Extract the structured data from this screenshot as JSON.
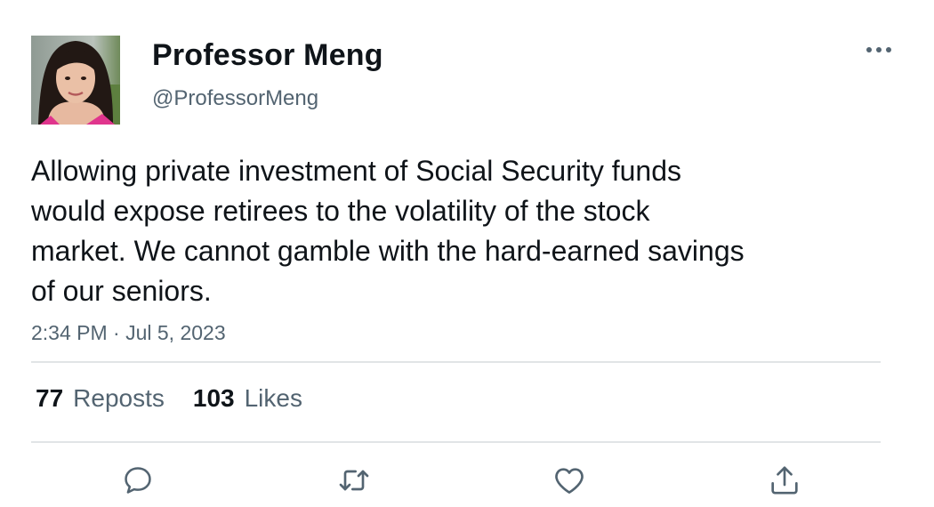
{
  "author": {
    "display_name": "Professor Meng",
    "handle": "@ProfessorMeng"
  },
  "tweet": {
    "text": "Allowing private investment of Social Security funds\nwould expose retirees to the volatility of the stock\nmarket. We cannot gamble with the hard-earned savings\nof our seniors.",
    "timestamp": "2:34 PM · Jul 5, 2023"
  },
  "stats": {
    "reposts_count": "77",
    "reposts_label": "Reposts",
    "likes_count": "103",
    "likes_label": "Likes"
  },
  "icons": {
    "more": "more-horizontal-icon",
    "reply": "reply-bubble-icon",
    "repost": "repost-arrows-icon",
    "like": "heart-icon",
    "share": "share-upload-icon"
  },
  "colors": {
    "text_primary": "#0f1419",
    "text_secondary": "#536471",
    "divider": "#e1e4e6",
    "icon": "#536471"
  }
}
